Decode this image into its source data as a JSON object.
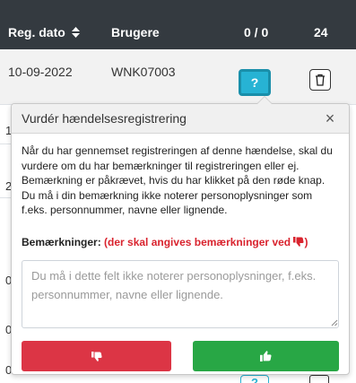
{
  "table": {
    "headers": {
      "date": "Reg. dato",
      "user": "Brugere",
      "count": "0 / 0",
      "num": "24"
    },
    "rows": [
      {
        "date": "10-09-2022",
        "user": "WNK07003",
        "action_label": "?"
      }
    ],
    "partial_rows": [
      "1",
      "2",
      "0",
      "0",
      "0"
    ]
  },
  "popover": {
    "title": "Vurdér hændelsesregistrering",
    "close_label": "×",
    "description": "Når du har gennemset registreringen af denne hændelse, skal du vurdere om du har bemærkninger til registreringen eller ej. Bemærkning er påkrævet, hvis du har klikket på den røde knap. Du må i din bemærkning ikke noterer personoplysninger som f.eks. personnummer, navne eller lignende.",
    "remarks_label": "Bemærkninger:",
    "remarks_required_note": "(der skal angives bemærkninger ved",
    "remarks_close": ")",
    "textarea_placeholder": "Du må i dette felt ikke noterer personoplysninger, f.eks. personnummer, navne eller lignende.",
    "textarea_value": ""
  },
  "icons": {
    "sort": "sort-icon",
    "trash": "trash-icon",
    "thumbs_down": "thumbs-down-icon",
    "thumbs_up": "thumbs-up-icon",
    "close": "close-icon"
  },
  "colors": {
    "header_bg": "#343a40",
    "info": "#27b3d4",
    "danger": "#dc3545",
    "success": "#28a745",
    "required_text": "#d9232e"
  }
}
